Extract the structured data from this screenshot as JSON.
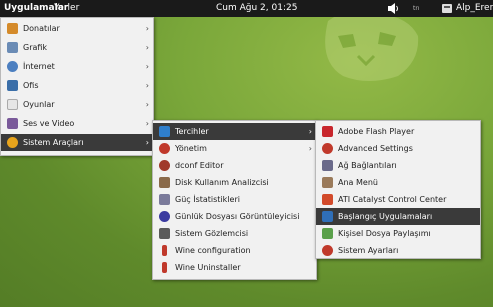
{
  "topbar": {
    "applications": "Uygulamalar",
    "places": "Yerler",
    "clock": "Cum Ağu 2, 01:25",
    "net": "trı",
    "user": "Alp_Eren"
  },
  "menu_main": {
    "items": [
      {
        "label": "Donatılar",
        "icon": "accessories-icon",
        "color": "#d48a2a"
      },
      {
        "label": "Grafik",
        "icon": "graphics-icon",
        "color": "#6a8bb5"
      },
      {
        "label": "İnternet",
        "icon": "internet-icon",
        "color": "#4c7fc0"
      },
      {
        "label": "Ofis",
        "icon": "office-icon",
        "color": "#3a6ea8"
      },
      {
        "label": "Oyunlar",
        "icon": "games-icon",
        "color": "#e6e6e6"
      },
      {
        "label": "Ses ve Video",
        "icon": "sound-video-icon",
        "color": "#7a5a9a"
      },
      {
        "label": "Sistem Araçları",
        "icon": "system-tools-icon",
        "color": "#e8a41c",
        "selected": true
      }
    ]
  },
  "menu_system": {
    "items": [
      {
        "label": "Tercihler",
        "icon": "preferences-icon",
        "color": "#2f7fcc",
        "submenu": true,
        "selected": true
      },
      {
        "label": "Yönetim",
        "icon": "administration-icon",
        "color": "#c0392b",
        "submenu": true
      },
      {
        "label": "dconf Editor",
        "icon": "dconf-icon",
        "color": "#a0392b"
      },
      {
        "label": "Disk Kullanım Analizcisi",
        "icon": "disk-usage-icon",
        "color": "#8a6a4a"
      },
      {
        "label": "Güç İstatistikleri",
        "icon": "power-statistics-icon",
        "color": "#7a7a9a"
      },
      {
        "label": "Günlük Dosyası Görüntüleyicisi",
        "icon": "log-viewer-icon",
        "color": "#3a3aa0"
      },
      {
        "label": "Sistem Gözlemcisi",
        "icon": "system-monitor-icon",
        "color": "#5a5a5a"
      },
      {
        "label": "Wine configuration",
        "icon": "wine-icon",
        "color": "#c0392b"
      },
      {
        "label": "Wine Uninstaller",
        "icon": "wine-uninstaller-icon",
        "color": "#c0392b"
      }
    ]
  },
  "menu_preferences": {
    "items": [
      {
        "label": "Adobe Flash Player",
        "icon": "flash-icon",
        "color": "#c8262c"
      },
      {
        "label": "Advanced Settings",
        "icon": "advanced-settings-icon",
        "color": "#c0392b"
      },
      {
        "label": "Ağ Bağlantıları",
        "icon": "network-connections-icon",
        "color": "#6a6a8a"
      },
      {
        "label": "Ana Menü",
        "icon": "main-menu-icon",
        "color": "#9a7a5a"
      },
      {
        "label": "ATI Catalyst Control Center",
        "icon": "ati-icon",
        "color": "#d24a2a"
      },
      {
        "label": "Başlangıç Uygulamaları",
        "icon": "startup-apps-icon",
        "color": "#2f6fb8",
        "selected": true
      },
      {
        "label": "Kişisel Dosya Paylaşımı",
        "icon": "file-sharing-icon",
        "color": "#5aa04a"
      },
      {
        "label": "Sistem Ayarları",
        "icon": "system-settings-icon",
        "color": "#c0392b"
      }
    ]
  }
}
